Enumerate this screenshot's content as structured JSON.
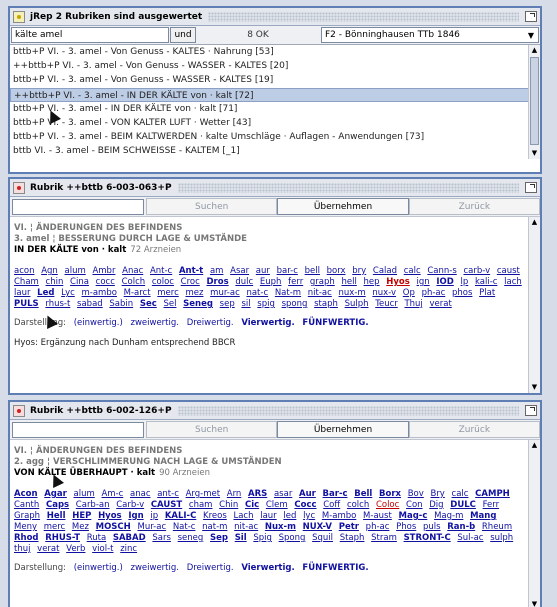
{
  "panel1": {
    "title": "jRep 2 Rubriken sind ausgewertet",
    "search_value": "kälte amel",
    "und_label": "und",
    "ok_count": "8 OK",
    "repertory": "F2 - Bönninghausen TTb 1846",
    "rows": [
      "bttb+P  VI. - 3. amel - Von Genuss - KALTES · Nahrung  [53]",
      "++bttb+P  VI. - 3. amel - Von Genuss - WASSER - KALTES [20]",
      "bttb+P  VI. - 3. amel - Von Genuss - WASSER - KALTES  [19]",
      "++bttb+P  VI. - 3. amel - IN DER KÄLTE von · kalt [72]",
      "bttb+P  VI. - 3. amel - IN DER KÄLTE von · kalt  [71]",
      "bttb+P  VI. - 3. amel - VON KALTER LUFT · Wetter  [43]",
      "bttb+P  VI. - 3. amel - BEIM KALTWERDEN · kalte Umschläge · Auflagen - Anwendungen  [73]",
      "bttb  VI. - 3. amel - BEIM SCHWEISSE - KALTEM  [_1]"
    ],
    "selected_index": 3
  },
  "panel2": {
    "title": "Rubrik  ++bttb 6-003-063+P",
    "btn_search": "Suchen",
    "btn_apply": "Übernehmen",
    "btn_back": "Zurück",
    "line1": "VI. ¦ ÄNDERUNGEN DES BEFINDENS",
    "line2": "3. amel ¦ BESSERUNG DURCH LAGE & UMSTÄNDE",
    "line3": "IN DER KÄLTE von · kalt",
    "count": "72 Arzneien",
    "remedies": [
      [
        "acon",
        ""
      ],
      [
        "Agn",
        ""
      ],
      [
        "alum",
        ""
      ],
      [
        "Ambr",
        ""
      ],
      [
        "Anac",
        ""
      ],
      [
        "Ant-c",
        ""
      ],
      [
        "Ant-t",
        "b"
      ],
      [
        "am",
        ""
      ],
      [
        "Asar",
        ""
      ],
      [
        "aur",
        ""
      ],
      [
        "bar-c",
        ""
      ],
      [
        "bell",
        ""
      ],
      [
        "borx",
        ""
      ],
      [
        "bry",
        ""
      ],
      [
        "Calad",
        ""
      ],
      [
        "calc",
        ""
      ],
      [
        "Cann-s",
        ""
      ],
      [
        "carb-v",
        ""
      ],
      [
        "caust",
        ""
      ],
      [
        "Cham",
        ""
      ],
      [
        "chin",
        ""
      ],
      [
        "Cina",
        ""
      ],
      [
        "cocc",
        ""
      ],
      [
        "Colch",
        ""
      ],
      [
        "coloc",
        ""
      ],
      [
        "Croc",
        ""
      ],
      [
        "Dros",
        "b"
      ],
      [
        "dulc",
        ""
      ],
      [
        "Euph",
        ""
      ],
      [
        "ferr",
        ""
      ],
      [
        "graph",
        ""
      ],
      [
        "hell",
        ""
      ],
      [
        "hep",
        ""
      ],
      [
        "Hyos",
        "rb"
      ],
      [
        "ign",
        ""
      ],
      [
        "IOD",
        "b"
      ],
      [
        "lp",
        ""
      ],
      [
        "kali-c",
        ""
      ],
      [
        "lach",
        ""
      ],
      [
        "laur",
        ""
      ],
      [
        "Led",
        "b"
      ],
      [
        "Lyc",
        ""
      ],
      [
        "m-ambo",
        ""
      ],
      [
        "M-arct",
        ""
      ],
      [
        "merc",
        ""
      ],
      [
        "mez",
        ""
      ],
      [
        "mur-ac",
        ""
      ],
      [
        "nat-c",
        ""
      ],
      [
        "Nat-m",
        ""
      ],
      [
        "nit-ac",
        ""
      ],
      [
        "nux-m",
        ""
      ],
      [
        "nux-v",
        ""
      ],
      [
        "Op",
        ""
      ],
      [
        "ph-ac",
        ""
      ],
      [
        "phos",
        ""
      ],
      [
        "Plat",
        ""
      ],
      [
        "PULS",
        "b"
      ],
      [
        "rhus-t",
        ""
      ],
      [
        "sabad",
        ""
      ],
      [
        "Sabin",
        ""
      ],
      [
        "Sec",
        "b"
      ],
      [
        "Sel",
        ""
      ],
      [
        "Seneg",
        "b"
      ],
      [
        "sep",
        ""
      ],
      [
        "sil",
        ""
      ],
      [
        "spig",
        ""
      ],
      [
        "spong",
        ""
      ],
      [
        "staph",
        ""
      ],
      [
        "Sulph",
        ""
      ],
      [
        "Teucr",
        ""
      ],
      [
        "Thuj",
        ""
      ],
      [
        "verat",
        ""
      ]
    ],
    "legend_label": "Darstellung:",
    "legend": [
      "(einwertig.)",
      "zweiwertig.",
      "Dreiwertig.",
      "Vierwertig.",
      "FÜNFWERTIG."
    ],
    "note": "Hyos: Ergänzung nach Dunham entsprechend BBCR"
  },
  "panel3": {
    "title": "Rubrik  ++bttb 6-002-126+P",
    "btn_search": "Suchen",
    "btn_apply": "Übernehmen",
    "btn_back": "Zurück",
    "line1": "VI. ¦ ÄNDERUNGEN DES BEFINDENS",
    "line2": "2. agg ¦ VERSCHLIMMERUNG NACH LAGE & UMSTÄNDEN",
    "line3": "VON KÄLTE ÜBERHAUPT · kalt",
    "count": "90 Arzneien",
    "remedies": [
      [
        "Acon",
        "b"
      ],
      [
        "Agar",
        "b"
      ],
      [
        "alum",
        ""
      ],
      [
        "Am-c",
        ""
      ],
      [
        "anac",
        ""
      ],
      [
        "ant-c",
        ""
      ],
      [
        "Arg-met",
        ""
      ],
      [
        "Arn",
        ""
      ],
      [
        "ARS",
        "b"
      ],
      [
        "asar",
        ""
      ],
      [
        "Aur",
        "b"
      ],
      [
        "Bar-c",
        "b"
      ],
      [
        "Bell",
        "b"
      ],
      [
        "Borx",
        "b"
      ],
      [
        "Bov",
        ""
      ],
      [
        "Bry",
        ""
      ],
      [
        "calc",
        ""
      ],
      [
        "CAMPH",
        "b"
      ],
      [
        "Canth",
        ""
      ],
      [
        "Caps",
        "b"
      ],
      [
        "Carb-an",
        ""
      ],
      [
        "Carb-v",
        ""
      ],
      [
        "CAUST",
        "b"
      ],
      [
        "cham",
        ""
      ],
      [
        "Chin",
        ""
      ],
      [
        "Cic",
        "b"
      ],
      [
        "Clem",
        ""
      ],
      [
        "Cocc",
        "b"
      ],
      [
        "Coff",
        ""
      ],
      [
        "colch",
        ""
      ],
      [
        "Coloc",
        "r"
      ],
      [
        "Con",
        ""
      ],
      [
        "Dig",
        ""
      ],
      [
        "DULC",
        "b"
      ],
      [
        "Ferr",
        ""
      ],
      [
        "Graph",
        ""
      ],
      [
        "Hell",
        "b"
      ],
      [
        "HEP",
        "b"
      ],
      [
        "Hyos",
        "b"
      ],
      [
        "Ign",
        "b"
      ],
      [
        "ip",
        ""
      ],
      [
        "KALI-C",
        "b"
      ],
      [
        "Kreos",
        ""
      ],
      [
        "Lach",
        ""
      ],
      [
        "laur",
        ""
      ],
      [
        "led",
        ""
      ],
      [
        "lyc",
        ""
      ],
      [
        "M-ambo",
        ""
      ],
      [
        "M-aust",
        ""
      ],
      [
        "Mag-c",
        "b"
      ],
      [
        "Mag-m",
        ""
      ],
      [
        "Mang",
        "b"
      ],
      [
        "Meny",
        ""
      ],
      [
        "merc",
        ""
      ],
      [
        "Mez",
        ""
      ],
      [
        "MOSCH",
        "b"
      ],
      [
        "Mur-ac",
        ""
      ],
      [
        "Nat-c",
        ""
      ],
      [
        "nat-m",
        ""
      ],
      [
        "nit-ac",
        ""
      ],
      [
        "Nux-m",
        "b"
      ],
      [
        "NUX-V",
        "b"
      ],
      [
        "Petr",
        "b"
      ],
      [
        "ph-ac",
        ""
      ],
      [
        "Phos",
        ""
      ],
      [
        "puls",
        ""
      ],
      [
        "Ran-b",
        "b"
      ],
      [
        "Rheum",
        ""
      ],
      [
        "Rhod",
        "b"
      ],
      [
        "RHUS-T",
        "b"
      ],
      [
        "Ruta",
        ""
      ],
      [
        "SABAD",
        "b"
      ],
      [
        "Sars",
        ""
      ],
      [
        "seneg",
        ""
      ],
      [
        "Sep",
        "b"
      ],
      [
        "Sil",
        "b"
      ],
      [
        "Spig",
        ""
      ],
      [
        "Spong",
        ""
      ],
      [
        "Squil",
        ""
      ],
      [
        "Staph",
        ""
      ],
      [
        "Stram",
        ""
      ],
      [
        "STRONT-C",
        "b"
      ],
      [
        "Sul-ac",
        ""
      ],
      [
        "sulph",
        ""
      ],
      [
        "thuj",
        ""
      ],
      [
        "verat",
        ""
      ],
      [
        "Verb",
        ""
      ],
      [
        "viol-t",
        ""
      ],
      [
        "zinc",
        ""
      ]
    ],
    "legend_label": "Darstellung:",
    "legend": [
      "(einwertig.)",
      "zweiwertig.",
      "Dreiwertig.",
      "Vierwertig.",
      "FÜNFWERTIG."
    ]
  }
}
